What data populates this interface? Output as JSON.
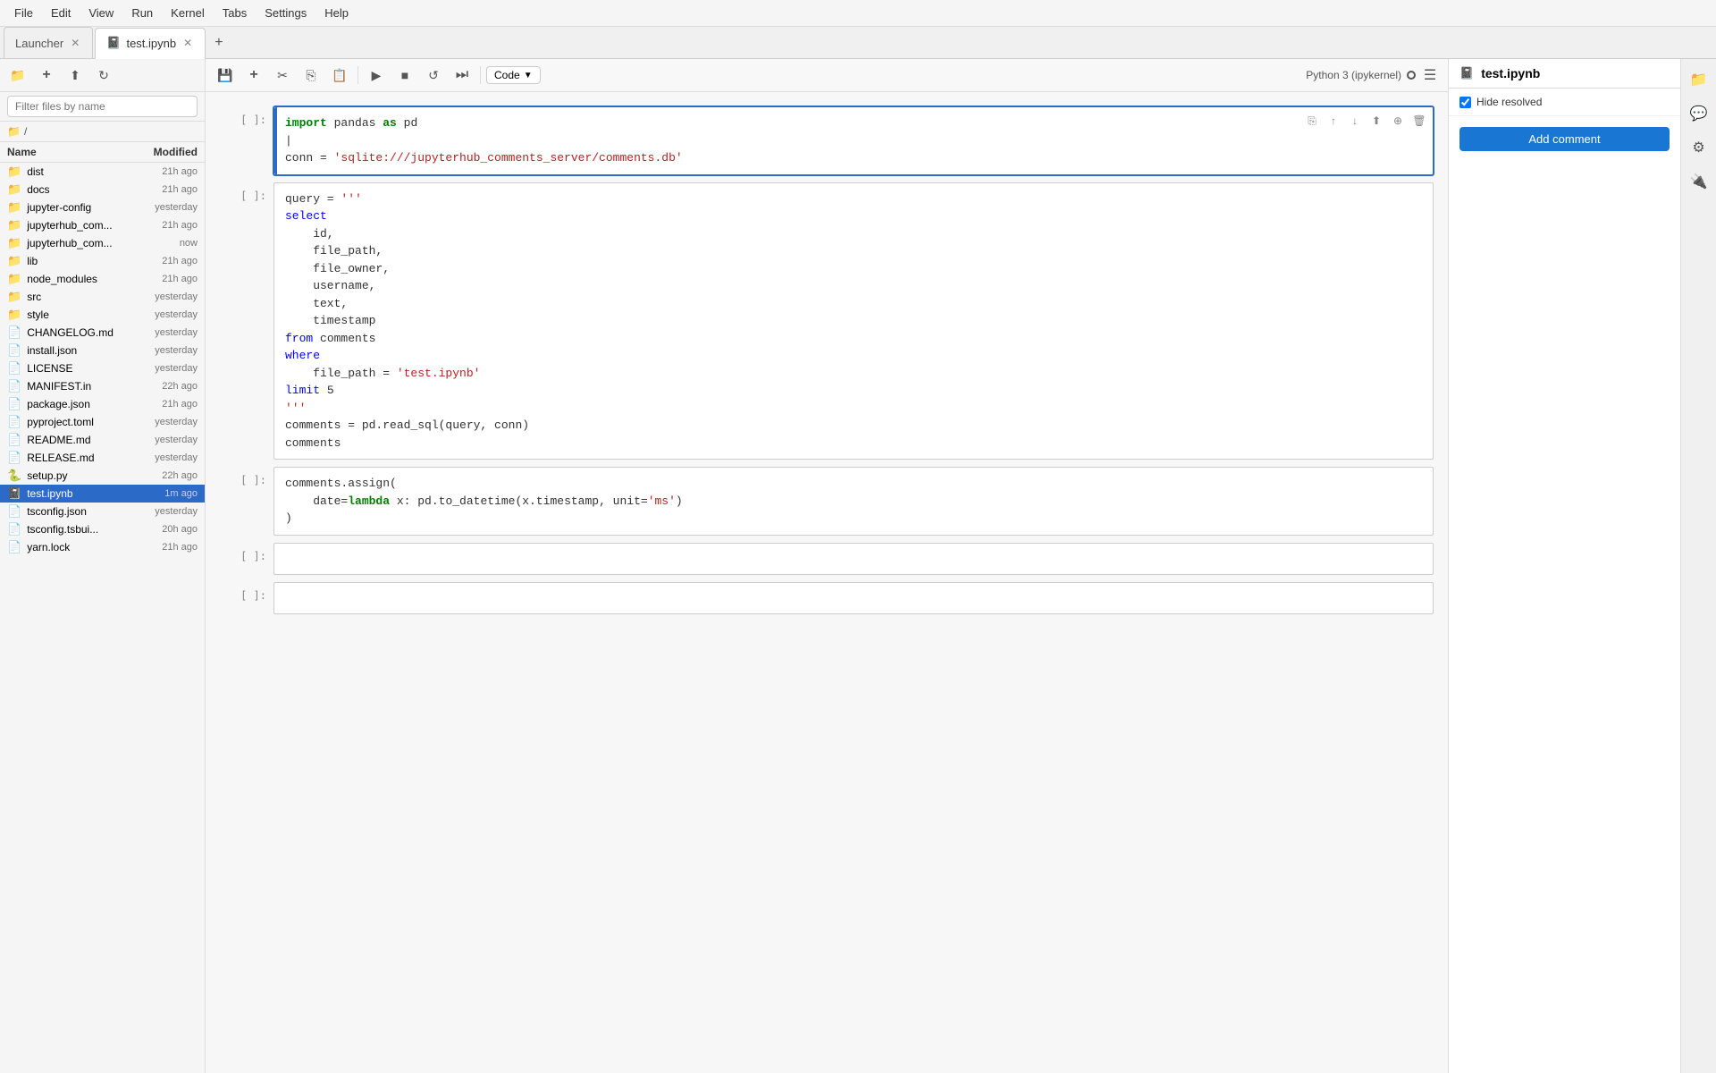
{
  "menubar": {
    "items": [
      "File",
      "Edit",
      "View",
      "Run",
      "Kernel",
      "Tabs",
      "Settings",
      "Help"
    ]
  },
  "tabs": [
    {
      "label": "Launcher",
      "active": false,
      "closable": true
    },
    {
      "label": "test.ipynb",
      "active": true,
      "closable": true
    }
  ],
  "sidebar": {
    "toolbar_buttons": [
      "folder-icon",
      "upload-icon",
      "refresh-icon"
    ],
    "search_placeholder": "Filter files by name",
    "path": "/",
    "columns": {
      "name": "Name",
      "modified": "Modified"
    },
    "files": [
      {
        "name": "dist",
        "type": "folder",
        "modified": "21h ago"
      },
      {
        "name": "docs",
        "type": "folder",
        "modified": "21h ago"
      },
      {
        "name": "jupyter-config",
        "type": "folder",
        "modified": "yesterday"
      },
      {
        "name": "jupyterhub_com...",
        "type": "folder",
        "modified": "21h ago"
      },
      {
        "name": "jupyterhub_com...",
        "type": "folder",
        "modified": "now"
      },
      {
        "name": "lib",
        "type": "folder",
        "modified": "21h ago"
      },
      {
        "name": "node_modules",
        "type": "folder",
        "modified": "21h ago"
      },
      {
        "name": "src",
        "type": "folder",
        "modified": "yesterday"
      },
      {
        "name": "style",
        "type": "folder",
        "modified": "yesterday"
      },
      {
        "name": "CHANGELOG.md",
        "type": "md",
        "modified": "yesterday"
      },
      {
        "name": "install.json",
        "type": "json",
        "modified": "yesterday"
      },
      {
        "name": "LICENSE",
        "type": "file",
        "modified": "yesterday"
      },
      {
        "name": "MANIFEST.in",
        "type": "file",
        "modified": "22h ago"
      },
      {
        "name": "package.json",
        "type": "json",
        "modified": "21h ago"
      },
      {
        "name": "pyproject.toml",
        "type": "toml",
        "modified": "yesterday"
      },
      {
        "name": "README.md",
        "type": "md",
        "modified": "yesterday"
      },
      {
        "name": "RELEASE.md",
        "type": "md",
        "modified": "yesterday"
      },
      {
        "name": "setup.py",
        "type": "py",
        "modified": "22h ago"
      },
      {
        "name": "test.ipynb",
        "type": "notebook",
        "modified": "1m ago",
        "selected": true
      },
      {
        "name": "tsconfig.json",
        "type": "json",
        "modified": "yesterday"
      },
      {
        "name": "tsconfig.tsbui...",
        "type": "json",
        "modified": "20h ago"
      },
      {
        "name": "yarn.lock",
        "type": "file",
        "modified": "21h ago"
      }
    ]
  },
  "notebook": {
    "toolbar": {
      "save_label": "💾",
      "add_label": "+",
      "cut_label": "✂",
      "copy_label": "⎘",
      "paste_label": "📋",
      "run_label": "▶",
      "stop_label": "■",
      "restart_label": "↺",
      "skip_label": "⏭",
      "cell_type": "Code",
      "kernel_name": "Python 3 (ipykernel)"
    },
    "cells": [
      {
        "id": 1,
        "label": "[ ]:",
        "active": true,
        "code_lines": [
          {
            "type": "import",
            "content": "import pandas as pd"
          },
          {
            "type": "blank",
            "content": ""
          },
          {
            "type": "assign",
            "content": "conn = 'sqlite:///jupyterhub_comments_server/comments.db'"
          }
        ]
      },
      {
        "id": 2,
        "label": "[ ]:",
        "active": false,
        "code_lines": [
          {
            "type": "assign_triple",
            "content": "query = '''"
          },
          {
            "type": "sql_kw",
            "content": "select"
          },
          {
            "type": "sql_field",
            "content": "    id,"
          },
          {
            "type": "sql_field",
            "content": "    file_path,"
          },
          {
            "type": "sql_field",
            "content": "    file_owner,"
          },
          {
            "type": "sql_field",
            "content": "    username,"
          },
          {
            "type": "sql_field",
            "content": "    text,"
          },
          {
            "type": "sql_field",
            "content": "    timestamp"
          },
          {
            "type": "sql_kw",
            "content": "from comments"
          },
          {
            "type": "sql_kw",
            "content": "where"
          },
          {
            "type": "sql_field",
            "content": "    file_path = 'test.ipynb'"
          },
          {
            "type": "sql_kw",
            "content": "limit 5"
          },
          {
            "type": "assign_triple",
            "content": "'''"
          },
          {
            "type": "assign",
            "content": "comments = pd.read_sql(query, conn)"
          },
          {
            "type": "plain",
            "content": "comments"
          }
        ]
      },
      {
        "id": 3,
        "label": "[ ]:",
        "active": false,
        "code_lines": [
          {
            "type": "method",
            "content": "comments.assign("
          },
          {
            "type": "kwarg",
            "content": "    date=lambda x: pd.to_datetime(x.timestamp, unit='ms')"
          },
          {
            "type": "close",
            "content": ")"
          }
        ]
      },
      {
        "id": 4,
        "label": "[ ]:",
        "active": false,
        "code_lines": []
      },
      {
        "id": 5,
        "label": "[ ]:",
        "active": false,
        "code_lines": []
      }
    ]
  },
  "right_panel": {
    "title": "test.ipynb",
    "file_icon": "📓",
    "hide_resolved_label": "Hide resolved",
    "hide_resolved_checked": true,
    "add_comment_label": "Add comment"
  },
  "far_right_icons": [
    "file-icon",
    "chat-icon",
    "settings-icon",
    "extension-icon"
  ]
}
